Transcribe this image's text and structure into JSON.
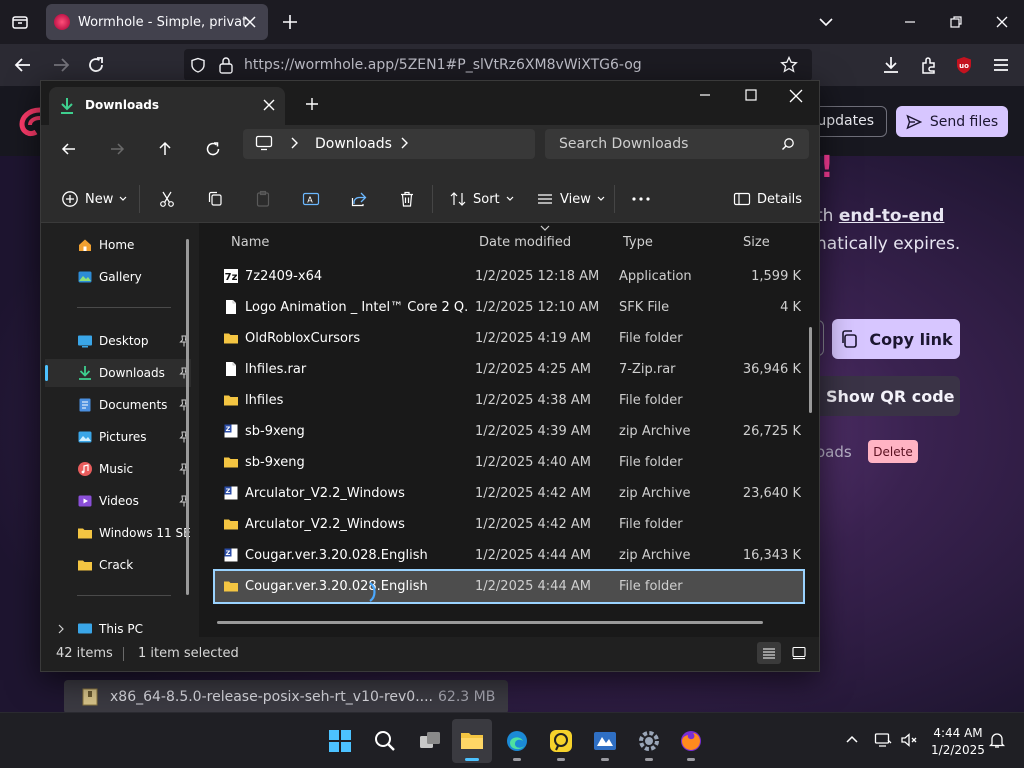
{
  "browser": {
    "tab_title": "Wormhole - Simple, private file sharing",
    "url": "https://wormhole.app/5ZEN1#P_slVtRz6XM8vWiXTG6-og"
  },
  "website": {
    "check_updates_label": "t updates",
    "send_files_label": "Send files",
    "headline_fragment": "!",
    "text_line1_prefix": "th ",
    "text_line1_emphasis": "end-to-end",
    "text_line2": "natically expires.",
    "copy_link_label": "Copy link",
    "qr_code_label": "Show QR code",
    "downloads_fragment": "oads",
    "delete_label": "Delete",
    "accent_color": "#d7c6ff"
  },
  "download_bar": {
    "filename": "x86_64-8.5.0-release-posix-seh-rt_v10-rev0....",
    "size": "62.3 MB"
  },
  "explorer": {
    "tab_label": "Downloads",
    "breadcrumb_label": "Downloads",
    "search_placeholder": "Search Downloads",
    "commands": {
      "new": "New",
      "sort": "Sort",
      "view": "View",
      "details": "Details"
    },
    "nav": [
      {
        "label": "Home",
        "icon": "home-icon"
      },
      {
        "label": "Gallery",
        "icon": "gallery-icon"
      },
      {
        "label": "Desktop",
        "icon": "desktop-icon"
      },
      {
        "label": "Downloads",
        "icon": "downloads-icon"
      },
      {
        "label": "Documents",
        "icon": "documents-icon"
      },
      {
        "label": "Pictures",
        "icon": "pictures-icon"
      },
      {
        "label": "Music",
        "icon": "music-icon"
      },
      {
        "label": "Videos",
        "icon": "videos-icon"
      },
      {
        "label": "Windows 11 SE",
        "icon": "folder-icon"
      },
      {
        "label": "Crack",
        "icon": "folder-icon"
      },
      {
        "label": "This PC",
        "icon": "pc-icon"
      }
    ],
    "columns": {
      "name": "Name",
      "date": "Date modified",
      "type": "Type",
      "size": "Size"
    },
    "files": [
      {
        "name": "7z2409-x64",
        "date": "1/2/2025 12:18 AM",
        "type": "Application",
        "size": "1,599 K",
        "icon": "7zip-app-icon"
      },
      {
        "name": "Logo Animation _ Intel™ Core 2 Q...",
        "date": "1/2/2025 12:10 AM",
        "type": "SFK File",
        "size": "4 K",
        "icon": "file-icon"
      },
      {
        "name": "OldRobloxCursors",
        "date": "1/2/2025 4:19 AM",
        "type": "File folder",
        "size": "",
        "icon": "folder-icon"
      },
      {
        "name": "lhfiles.rar",
        "date": "1/2/2025 4:25 AM",
        "type": "7-Zip.rar",
        "size": "36,946 K",
        "icon": "file-icon"
      },
      {
        "name": "lhfiles",
        "date": "1/2/2025 4:38 AM",
        "type": "File folder",
        "size": "",
        "icon": "folder-icon"
      },
      {
        "name": "sb-9xeng",
        "date": "1/2/2025 4:39 AM",
        "type": "zip Archive",
        "size": "26,725 K",
        "icon": "zip-icon"
      },
      {
        "name": "sb-9xeng",
        "date": "1/2/2025 4:40 AM",
        "type": "File folder",
        "size": "",
        "icon": "folder-icon"
      },
      {
        "name": "Arculator_V2.2_Windows",
        "date": "1/2/2025 4:42 AM",
        "type": "zip Archive",
        "size": "23,640 K",
        "icon": "zip-icon"
      },
      {
        "name": "Arculator_V2.2_Windows",
        "date": "1/2/2025 4:42 AM",
        "type": "File folder",
        "size": "",
        "icon": "folder-icon"
      },
      {
        "name": "Cougar.ver.3.20.028.English",
        "date": "1/2/2025 4:44 AM",
        "type": "zip Archive",
        "size": "16,343 K",
        "icon": "zip-icon"
      },
      {
        "name": "Cougar.ver.3.20.028.English",
        "date": "1/2/2025 4:44 AM",
        "type": "File folder",
        "size": "",
        "icon": "folder-icon",
        "selected": true
      }
    ],
    "status": {
      "count": "42 items",
      "selected": "1 item selected"
    }
  },
  "taskbar": {
    "time": "4:44 AM",
    "date": "1/2/2025",
    "apps": [
      "start-icon",
      "search-icon",
      "task-view-icon",
      "file-explorer-icon",
      "edge-icon",
      "teams-icon",
      "store-icon",
      "settings-icon",
      "firefox-icon"
    ]
  }
}
